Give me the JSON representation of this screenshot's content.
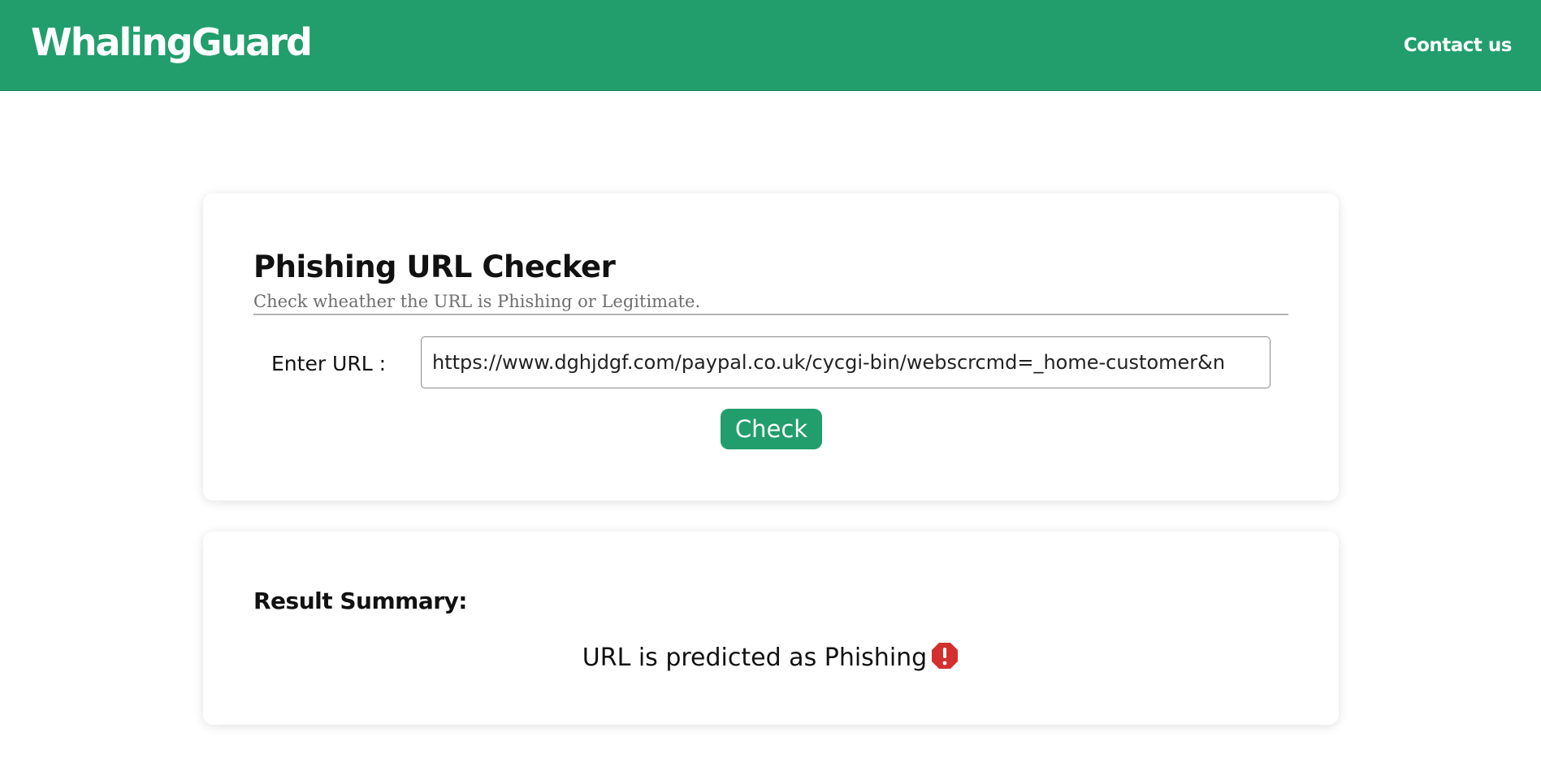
{
  "navbar": {
    "brand": "WhalingGuard",
    "contact_link": "Contact us",
    "color": "#219e6b"
  },
  "checker": {
    "title": "Phishing URL Checker",
    "subtitle": "Check wheather the URL is Phishing or Legitimate.",
    "url_label": "Enter URL :",
    "url_value": "https://www.dghjdgf.com/paypal.co.uk/cycgi-bin/webscrcmd=_home-customer&n",
    "check_button": "Check"
  },
  "result": {
    "heading": "Result Summary:",
    "message": "URL is predicted as Phishing",
    "status_icon": "warning-octagon-icon",
    "status_color": "#d32f2f"
  }
}
